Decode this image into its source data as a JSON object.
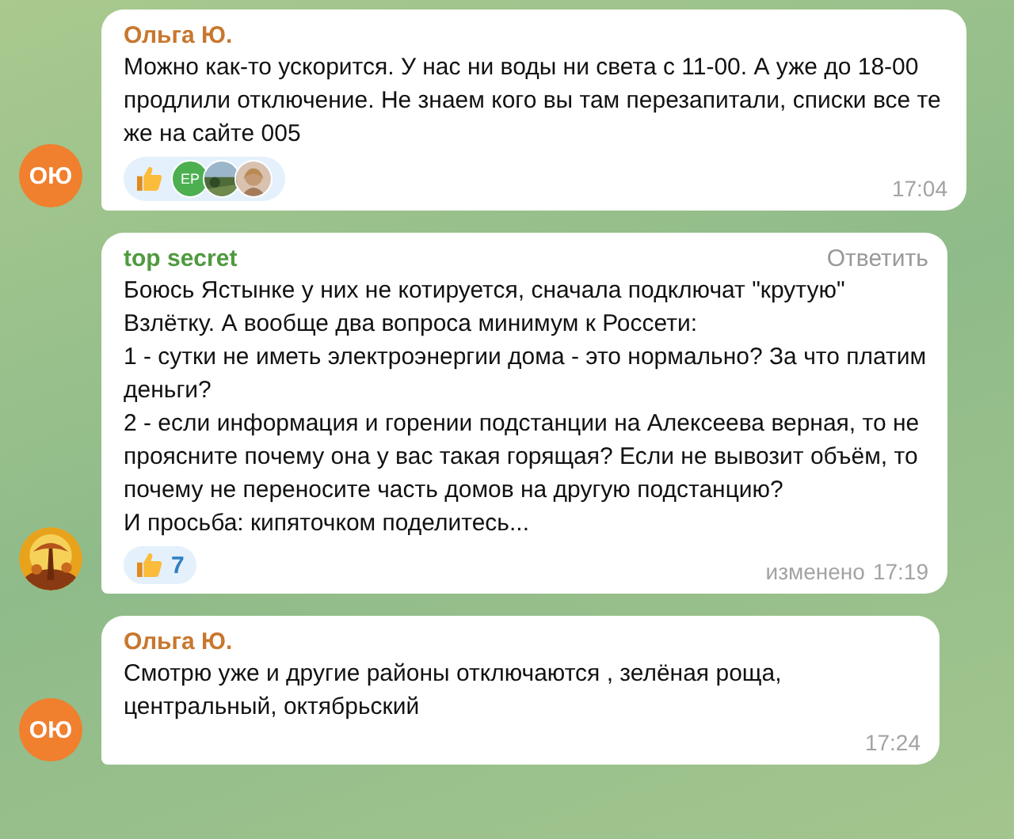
{
  "messages": [
    {
      "author": "Ольга Ю.",
      "color": "#c8772e",
      "avatar": {
        "kind": "initials",
        "initials": "ОЮ",
        "color": "#f07f2e"
      },
      "text": "Можно как-то ускорится. У нас ни воды ни света с 11-00. А уже до 18-00 продлили отключение. Не знаем кого вы там перезапитали, списки все те же на сайте 005",
      "reaction": {
        "kind": "users",
        "users": [
          {
            "kind": "initials",
            "initials": "ЕР",
            "color": "#4caf50"
          },
          {
            "kind": "picture"
          },
          {
            "kind": "picture"
          }
        ]
      },
      "time": "17:04"
    },
    {
      "author": "top secret",
      "color": "#4f9a3f",
      "avatar": {
        "kind": "picture"
      },
      "reply_label": "Ответить",
      "text": "Боюсь Ястынке у них не котируется, сначала подключат \"крутую\" Взлётку. А вообще два вопроса минимум к Россети:\n1 - сутки не иметь электроэнергии дома - это нормально? За что платим деньги?\n2 - если информация и горении подстанции на Алексеева верная, то не проясните почему она у вас такая горящая? Если не вывозит объём, то почему не переносите часть домов на другую подстанцию?\nИ просьба: кипяточком поделитесь...",
      "reaction": {
        "kind": "count",
        "count": "7"
      },
      "edited": "изменено",
      "time": "17:19"
    },
    {
      "author": "Ольга Ю.",
      "color": "#c8772e",
      "avatar": {
        "kind": "initials",
        "initials": "ОЮ",
        "color": "#f07f2e"
      },
      "text": "Смотрю уже и другие районы отключаются , зелёная роща, центральный, октябрьский",
      "time": "17:24"
    }
  ]
}
